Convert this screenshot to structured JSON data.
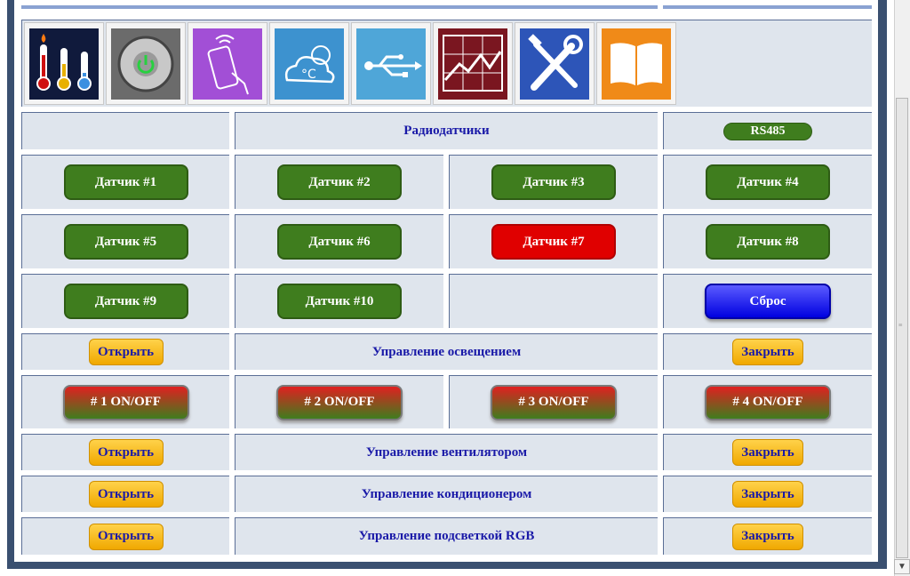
{
  "icons": [
    {
      "name": "thermometer-icon"
    },
    {
      "name": "power-icon"
    },
    {
      "name": "remote-control-icon"
    },
    {
      "name": "weather-icon"
    },
    {
      "name": "usb-icon"
    },
    {
      "name": "chart-icon"
    },
    {
      "name": "tools-icon"
    },
    {
      "name": "book-icon"
    }
  ],
  "header": {
    "radio_title": "Радиодатчики",
    "rs485_label": "RS485"
  },
  "sensors": [
    {
      "label": "Датчик #1",
      "state": "ok"
    },
    {
      "label": "Датчик #2",
      "state": "ok"
    },
    {
      "label": "Датчик #3",
      "state": "ok"
    },
    {
      "label": "Датчик #4",
      "state": "ok"
    },
    {
      "label": "Датчик #5",
      "state": "ok"
    },
    {
      "label": "Датчик #6",
      "state": "ok"
    },
    {
      "label": "Датчик #7",
      "state": "alarm"
    },
    {
      "label": "Датчик #8",
      "state": "ok"
    },
    {
      "label": "Датчик #9",
      "state": "ok"
    },
    {
      "label": "Датчик #10",
      "state": "ok"
    }
  ],
  "reset_label": "Сброс",
  "lighting": {
    "open": "Открыть",
    "title": "Управление освещением",
    "close": "Закрыть",
    "toggles": [
      "# 1 ON/OFF",
      "# 2 ON/OFF",
      "# 3 ON/OFF",
      "# 4 ON/OFF"
    ]
  },
  "fan": {
    "open": "Открыть",
    "title": "Управление вентилятором",
    "close": "Закрыть"
  },
  "ac": {
    "open": "Открыть",
    "title": "Управление кондиционером",
    "close": "Закрыть"
  },
  "rgb": {
    "open": "Открыть",
    "title": "Управление подсветкой RGB",
    "close": "Закрыть"
  },
  "colors": {
    "ok": "#3f7d1e",
    "alarm": "#e00000",
    "title": "#1a1aa8",
    "cell_bg": "#dfe5ed"
  }
}
